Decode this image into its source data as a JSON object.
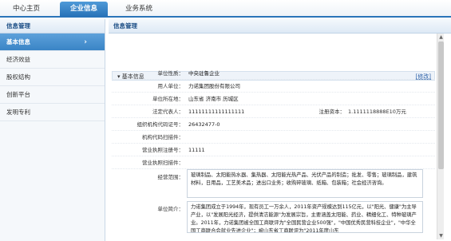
{
  "nav": {
    "tabs": [
      {
        "label": "中心主页"
      },
      {
        "label": "企业信息"
      },
      {
        "label": "业务系统"
      }
    ]
  },
  "sidebar": {
    "title": "信息管理",
    "items": [
      {
        "label": "基本信息",
        "active": true
      },
      {
        "label": "经济效益"
      },
      {
        "label": "股权结构"
      },
      {
        "label": "创新平台"
      },
      {
        "label": "发明专利"
      }
    ]
  },
  "main": {
    "title": "信息管理",
    "section_title": "基本信息",
    "edit_label": "[修改]"
  },
  "form": {
    "unit_type_label": "单位性质：",
    "unit_type": "中央驻鲁企业",
    "employer_label": "用人单位：",
    "employer": "力诺集团股份有限公司",
    "location_label": "单位所在地：",
    "location": "山东省 济南市 历城区",
    "legal_rep_label": "法定代表人：",
    "legal_rep": "11111111111111111",
    "capital_label": "注册资本：",
    "capital": "1.1111118888E10万元",
    "org_code_label": "组织机构代码证号：",
    "org_code": "26432477-0",
    "org_scan_label": "机构代码扫描件：",
    "org_scan": "",
    "license_no_label": "营业执照注册号：",
    "license_no": "11111",
    "license_scan_label": "营业执照扫描件：",
    "license_scan": "",
    "scope_label": "经营范围：",
    "scope": "玻璃制品、太阳能热水器、集热器、太阳能光热产品、光伏产品的制造；批发、零售；玻璃制品，建筑材料，日用品，工艺美术品；进出口业务；收购碎玻璃、纸箱、包装箱；社会经济咨询。",
    "intro_label": "单位简介：",
    "intro": "力诺集团成立于1994年，现有员工一万余人，2011年资产规模达到115亿元，以\"阳光、健康\"为主导产业，以\"发展阳光经济，提供清洁能源\"为发展宗旨，主要涵盖太阳能、药业、精细化工、特种玻璃产业。2011年，力诺集团被全国工商联评为\"全国民营企业500强\"，\"中国优秀民营科技企业\"，\"中华全国工商联合会就业先进企业\"；被山东省工商联评为\"2011年度山东"
  }
}
